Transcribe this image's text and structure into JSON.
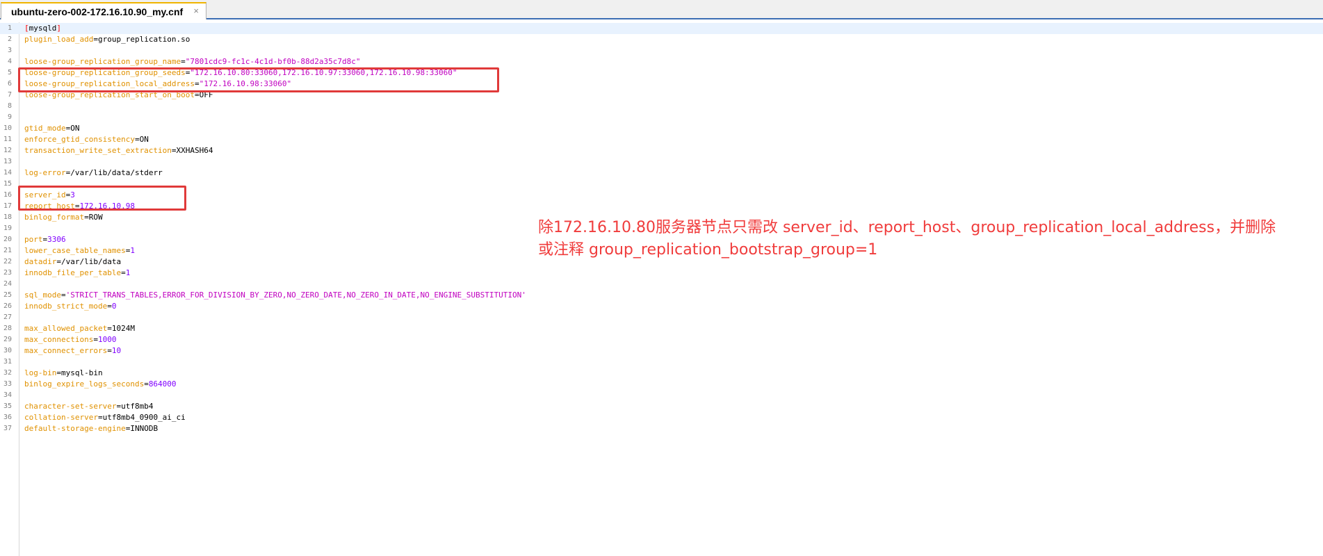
{
  "tab": {
    "title": "ubuntu-zero-002-172.16.10.90_my.cnf",
    "close_glyph": "×"
  },
  "lines": [
    {
      "num": "1",
      "section": "mysqld"
    },
    {
      "num": "2",
      "key": "plugin_load_add",
      "value": "group_replication.so",
      "vtype": "v"
    },
    {
      "num": "3"
    },
    {
      "num": "4",
      "key": "loose-group_replication_group_name",
      "value": "\"7801cdc9-fc1c-4c1d-bf0b-88d2a35c7d8c\"",
      "vtype": "s"
    },
    {
      "num": "5",
      "key": "loose-group_replication_group_seeds",
      "value": "\"172.16.10.80:33060,172.16.10.97:33060,172.16.10.98:33060\"",
      "vtype": "s"
    },
    {
      "num": "6",
      "key": "loose-group_replication_local_address",
      "value": "\"172.16.10.98:33060\"",
      "vtype": "s"
    },
    {
      "num": "7",
      "key": "loose-group_replication_start_on_boot",
      "value": "OFF",
      "vtype": "v"
    },
    {
      "num": "8"
    },
    {
      "num": "9"
    },
    {
      "num": "10",
      "key": "gtid_mode",
      "value": "ON",
      "vtype": "v"
    },
    {
      "num": "11",
      "key": "enforce_gtid_consistency",
      "value": "ON",
      "vtype": "v"
    },
    {
      "num": "12",
      "key": "transaction_write_set_extraction",
      "value": "XXHASH64",
      "vtype": "v"
    },
    {
      "num": "13"
    },
    {
      "num": "14",
      "key": "log-error",
      "value": "/var/lib/data/stderr",
      "vtype": "v"
    },
    {
      "num": "15"
    },
    {
      "num": "16",
      "key": "server_id",
      "value": "3",
      "vtype": "n"
    },
    {
      "num": "17",
      "key": "report_host",
      "value": "172.16.10.98",
      "vtype": "n"
    },
    {
      "num": "18",
      "key": "binlog_format",
      "value": "ROW",
      "vtype": "v"
    },
    {
      "num": "19"
    },
    {
      "num": "20",
      "key": "port",
      "value": "3306",
      "vtype": "n"
    },
    {
      "num": "21",
      "key": "lower_case_table_names",
      "value": "1",
      "vtype": "n"
    },
    {
      "num": "22",
      "key": "datadir",
      "value": "/var/lib/data",
      "vtype": "v"
    },
    {
      "num": "23",
      "key": "innodb_file_per_table",
      "value": "1",
      "vtype": "n"
    },
    {
      "num": "24"
    },
    {
      "num": "25",
      "key": "sql_mode",
      "value": "'STRICT_TRANS_TABLES,ERROR_FOR_DIVISION_BY_ZERO,NO_ZERO_DATE,NO_ZERO_IN_DATE,NO_ENGINE_SUBSTITUTION'",
      "vtype": "s"
    },
    {
      "num": "26",
      "key": "innodb_strict_mode",
      "value": "0",
      "vtype": "n"
    },
    {
      "num": "27"
    },
    {
      "num": "28",
      "key": "max_allowed_packet",
      "value": "1024M",
      "vtype": "v"
    },
    {
      "num": "29",
      "key": "max_connections",
      "value": "1000",
      "vtype": "n"
    },
    {
      "num": "30",
      "key": "max_connect_errors",
      "value": "10",
      "vtype": "n"
    },
    {
      "num": "31"
    },
    {
      "num": "32",
      "key": "log-bin",
      "value": "mysql-bin",
      "vtype": "v"
    },
    {
      "num": "33",
      "key": "binlog_expire_logs_seconds",
      "value": "864000",
      "vtype": "n"
    },
    {
      "num": "34"
    },
    {
      "num": "35",
      "key": "character-set-server",
      "value": "utf8mb4",
      "vtype": "v"
    },
    {
      "num": "36",
      "key": "collation-server",
      "value": "utf8mb4_0900_ai_ci",
      "vtype": "v"
    },
    {
      "num": "37",
      "key": "default-storage-engine",
      "value": "INNODB",
      "vtype": "v"
    }
  ],
  "annotation": {
    "line1": "除172.16.10.80服务器节点只需改 server_id、report_host、group_replication_local_address，并删除",
    "line2": "或注释 group_replication_bootstrap_group=1"
  },
  "colors": {
    "key": "#e09100",
    "number": "#8000ff",
    "string": "#c000c0",
    "highlight_box": "#e03a3a",
    "annotation": "#f03c3c",
    "tab_accent": "#f0b400",
    "current_line": "#e8f2fe"
  }
}
